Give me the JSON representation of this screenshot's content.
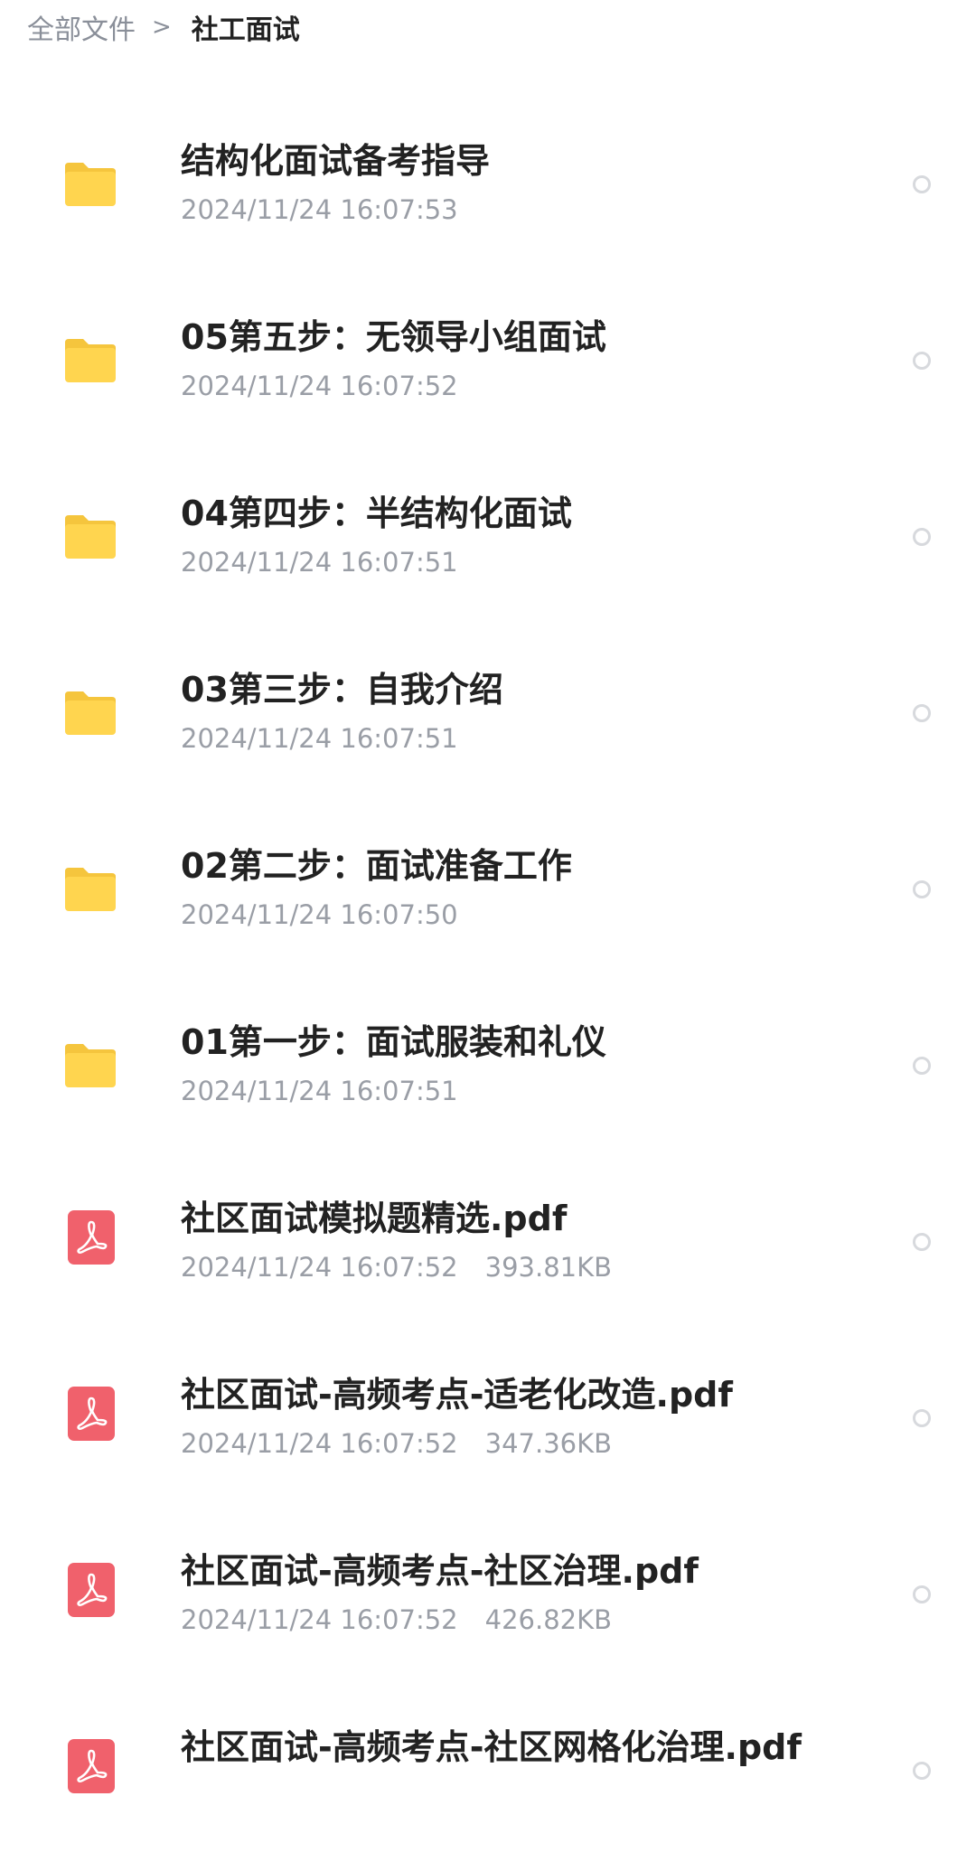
{
  "breadcrumb": {
    "root": "全部文件",
    "separator": ">",
    "current": "社工面试"
  },
  "colors": {
    "folder": "#FFD54F",
    "folder_tab": "#F5C53D",
    "pdf": "#F0616C"
  },
  "files": [
    {
      "type": "folder",
      "icon": "folder-icon",
      "name": "结构化面试备考指导",
      "date": "2024/11/24 16:07:53",
      "size": ""
    },
    {
      "type": "folder",
      "icon": "folder-icon",
      "name": "05第五步：无领导小组面试",
      "date": "2024/11/24 16:07:52",
      "size": ""
    },
    {
      "type": "folder",
      "icon": "folder-icon",
      "name": "04第四步：半结构化面试",
      "date": "2024/11/24 16:07:51",
      "size": ""
    },
    {
      "type": "folder",
      "icon": "folder-icon",
      "name": "03第三步：自我介绍",
      "date": "2024/11/24 16:07:51",
      "size": ""
    },
    {
      "type": "folder",
      "icon": "folder-icon",
      "name": "02第二步：面试准备工作",
      "date": "2024/11/24 16:07:50",
      "size": ""
    },
    {
      "type": "folder",
      "icon": "folder-icon",
      "name": "01第一步：面试服装和礼仪",
      "date": "2024/11/24 16:07:51",
      "size": ""
    },
    {
      "type": "pdf",
      "icon": "pdf-icon",
      "name": "社区面试模拟题精选.pdf",
      "date": "2024/11/24 16:07:52",
      "size": "393.81KB"
    },
    {
      "type": "pdf",
      "icon": "pdf-icon",
      "name": "社区面试-高频考点-适老化改造.pdf",
      "date": "2024/11/24 16:07:52",
      "size": "347.36KB"
    },
    {
      "type": "pdf",
      "icon": "pdf-icon",
      "name": "社区面试-高频考点-社区治理.pdf",
      "date": "2024/11/24 16:07:52",
      "size": "426.82KB"
    },
    {
      "type": "pdf",
      "icon": "pdf-icon",
      "name": "社区面试-高频考点-社区网格化治理.pdf",
      "date": "",
      "size": ""
    }
  ]
}
